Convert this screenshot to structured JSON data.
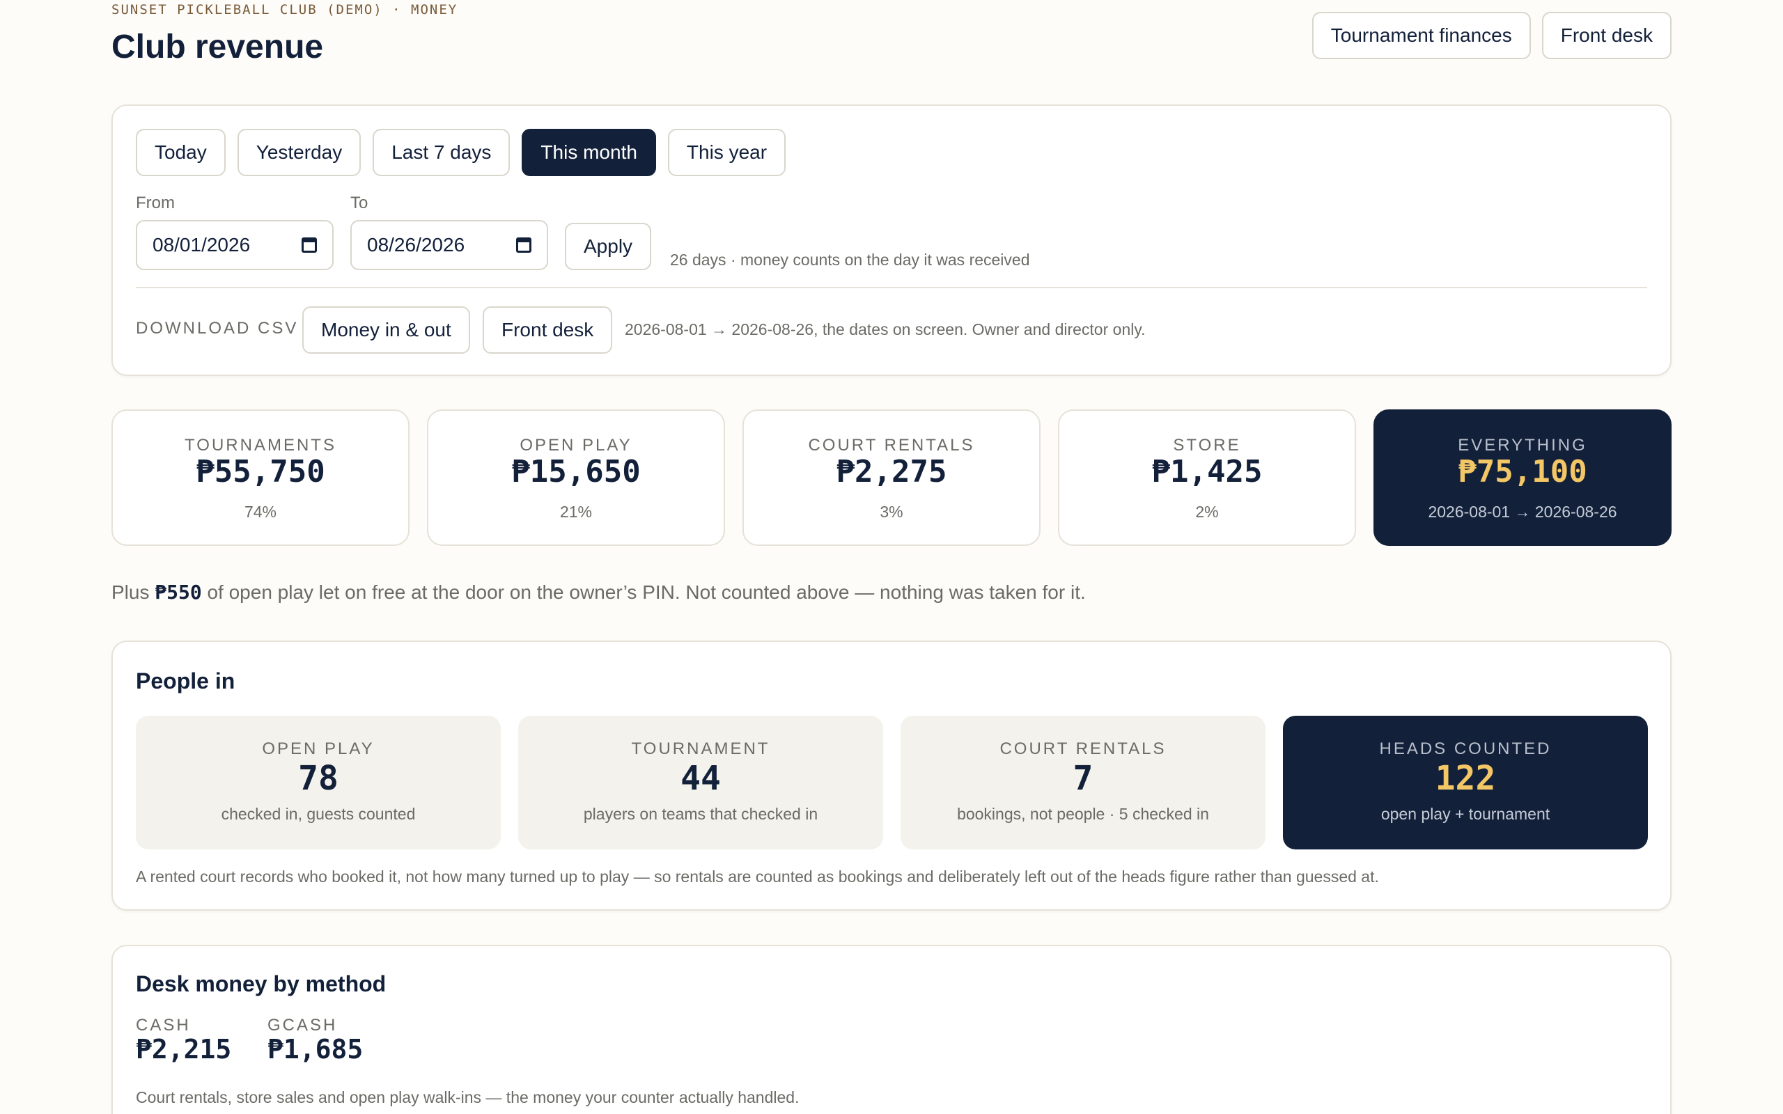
{
  "header": {
    "eyebrow": "SUNSET PICKLEBALL CLUB (DEMO) · MONEY",
    "title": "Club revenue",
    "actions": [
      "Tournament finances",
      "Front desk"
    ]
  },
  "range": {
    "presets": [
      "Today",
      "Yesterday",
      "Last 7 days",
      "This month",
      "This year"
    ],
    "active": "This month",
    "from_label": "From",
    "to_label": "To",
    "from_value": "08/01/2026",
    "to_value": "08/26/2026",
    "apply_label": "Apply",
    "hint": "26 days · money counts on the day it was received"
  },
  "csv": {
    "label": "DOWNLOAD CSV",
    "buttons": [
      "Money in & out",
      "Front desk"
    ],
    "note": "2026-08-01 → 2026-08-26, the dates on screen. Owner and director only."
  },
  "stats": [
    {
      "label": "TOURNAMENTS",
      "value": "₱55,750",
      "sub": "74%"
    },
    {
      "label": "OPEN PLAY",
      "value": "₱15,650",
      "sub": "21%"
    },
    {
      "label": "COURT RENTALS",
      "value": "₱2,275",
      "sub": "3%"
    },
    {
      "label": "STORE",
      "value": "₱1,425",
      "sub": "2%"
    },
    {
      "label": "EVERYTHING",
      "value": "₱75,100",
      "sub": "2026-08-01 → 2026-08-26"
    }
  ],
  "free_note": {
    "before": "Plus ",
    "amount": "₱550",
    "after": " of open play let on free at the door on the owner’s PIN. Not counted above — nothing was taken for it."
  },
  "people": {
    "title": "People in",
    "tiles": [
      {
        "label": "OPEN PLAY",
        "value": "78",
        "sub": "checked in, guests counted"
      },
      {
        "label": "TOURNAMENT",
        "value": "44",
        "sub": "players on teams that checked in"
      },
      {
        "label": "COURT RENTALS",
        "value": "7",
        "sub": "bookings, not people · 5 checked in"
      },
      {
        "label": "HEADS COUNTED",
        "value": "122",
        "sub": "open play + tournament"
      }
    ],
    "note": "A rented court records who booked it, not how many turned up to play — so rentals are counted as bookings and deliberately left out of the heads figure rather than guessed at."
  },
  "desk": {
    "title": "Desk money by method",
    "methods": [
      {
        "label": "CASH",
        "value": "₱2,215"
      },
      {
        "label": "GCASH",
        "value": "₱1,685"
      }
    ],
    "note": "Court rentals, store sales and open play walk-ins — the money your counter actually handled."
  },
  "colors": {
    "navy": "#13203a",
    "gold": "#f3c766",
    "page_bg": "#fdfcf8",
    "eyebrow": "#7a5b3a"
  }
}
